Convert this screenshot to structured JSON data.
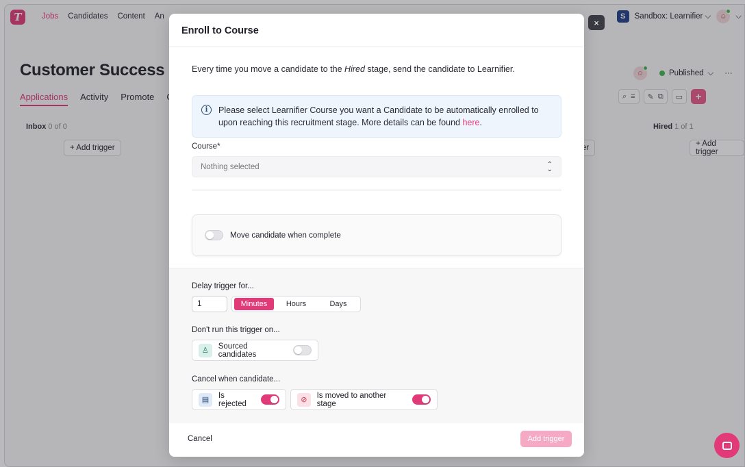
{
  "app": {
    "logo_letter": "T",
    "nav": [
      "Jobs",
      "Candidates",
      "Content",
      "An"
    ],
    "workspace_badge": "S",
    "workspace_name": "Sandbox: Learnifier",
    "page_title": "Customer Success",
    "tabs": [
      "Applications",
      "Activity",
      "Promote",
      "C"
    ],
    "status": "Published",
    "more": "···",
    "columns": [
      {
        "name": "Inbox",
        "count": "0 of 0"
      },
      {
        "name": "Hired",
        "count": "1 of 1"
      }
    ],
    "add_trigger_label": "+ Add trigger",
    "partial_add_trigger": "er",
    "accent": "#e23a78"
  },
  "modal": {
    "title": "Enroll to Course",
    "intro_before": "Every time you move a candidate to the ",
    "intro_stage": "Hired",
    "intro_after": " stage, send the candidate to Learnifier.",
    "info_text": "Please select Learnifier Course you want a Candidate to be automatically enrolled to upon reaching this recruitment stage. More details can be found ",
    "info_link": "here",
    "info_end": ".",
    "course_label": "Course*",
    "course_placeholder": "Nothing selected",
    "move_label": "Move candidate when complete",
    "move_enabled": false,
    "delay_label": "Delay trigger for...",
    "delay_value": "1",
    "delay_units": [
      "Minutes",
      "Hours",
      "Days"
    ],
    "delay_unit_selected": "Minutes",
    "dont_run_label": "Don't run this trigger on...",
    "sourced_label": "Sourced candidates",
    "sourced_enabled": false,
    "cancel_when_label": "Cancel when candidate...",
    "is_rejected_label": "Is rejected",
    "is_rejected_enabled": true,
    "is_moved_label": "Is moved to another stage",
    "is_moved_enabled": true,
    "cancel_button": "Cancel",
    "submit_button": "Add trigger",
    "close_glyph": "×"
  }
}
